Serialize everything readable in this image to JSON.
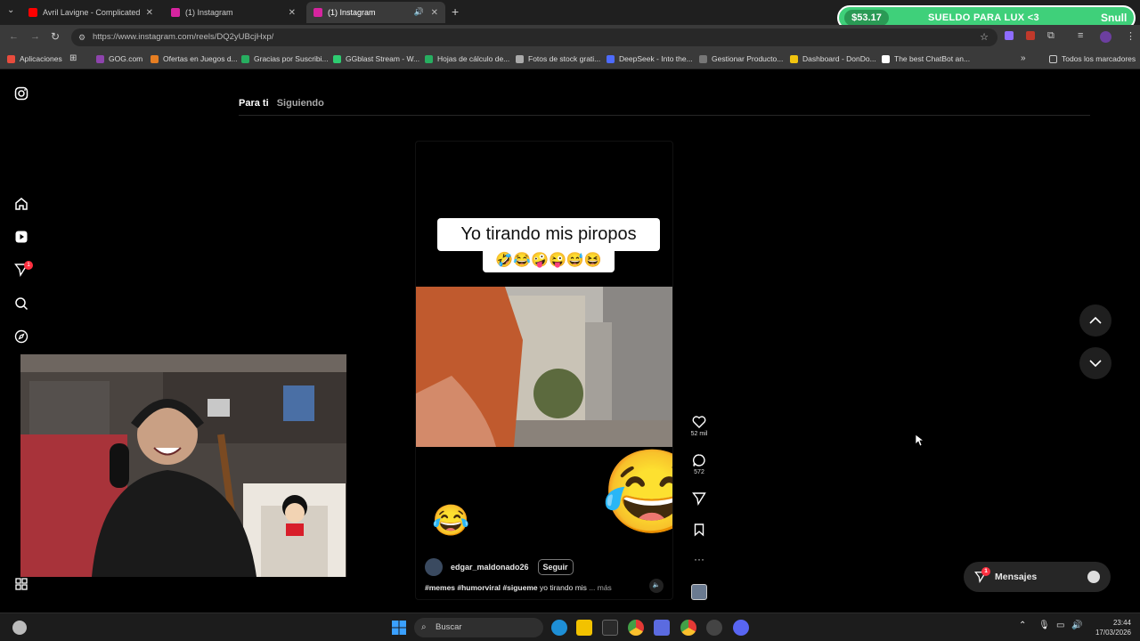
{
  "tabs": [
    {
      "title": "Avril Lavigne - Complicated (Of",
      "favicon_color": "#ff0000"
    },
    {
      "title": "(1) Instagram",
      "favicon_color": "#d6249f"
    },
    {
      "title": "(1) Instagram",
      "favicon_color": "#d6249f",
      "active": true
    }
  ],
  "address": {
    "url": "https://www.instagram.com/reels/DQ2yUBcjHxp/"
  },
  "bookmarks": [
    {
      "label": "Aplicaciones",
      "color": "#e84c3d"
    },
    {
      "label": "GOG.com",
      "color": "#8e44ad"
    },
    {
      "label": "Ofertas en Juegos d...",
      "color": "#e67e22"
    },
    {
      "label": "Gracias por Suscribi...",
      "color": "#27ae60"
    },
    {
      "label": "GGblast Stream - W...",
      "color": "#2ecc71"
    },
    {
      "label": "Hojas de cálculo de...",
      "color": "#27ae60"
    },
    {
      "label": "Fotos de stock grati...",
      "color": "#aaaaaa"
    },
    {
      "label": "DeepSeek - Into the...",
      "color": "#4d6bfe"
    },
    {
      "label": "Gestionar Producto...",
      "color": "#777777"
    },
    {
      "label": "Dashboard - DonDo...",
      "color": "#f1c40f"
    },
    {
      "label": "The best ChatBot an...",
      "color": "#ffffff"
    }
  ],
  "bookmarks_folder": "Todos los marcadores",
  "banner": {
    "amount": "$53.17",
    "message": "SUELDO PARA LUX <3",
    "user": "Snull"
  },
  "feed_tabs": {
    "for_you": "Para ti",
    "following": "Siguiendo"
  },
  "notification_count": "1",
  "reel": {
    "caption_line1": "Yo tirando mis piropos",
    "caption_emojis": "🤣😂🤪😜😅😆",
    "username": "edgar_maldonado26",
    "follow_label": "Seguir",
    "hashtags": "#memes #humorviral #sigueme",
    "caption_text": "yo tirando mis",
    "more_label": "... más"
  },
  "actions": {
    "likes": "52 mil",
    "comments": "572"
  },
  "messages": {
    "label": "Mensajes",
    "badge": "1"
  },
  "taskbar": {
    "search_placeholder": "Buscar",
    "time": "23:44",
    "date": "17/03/2026"
  }
}
